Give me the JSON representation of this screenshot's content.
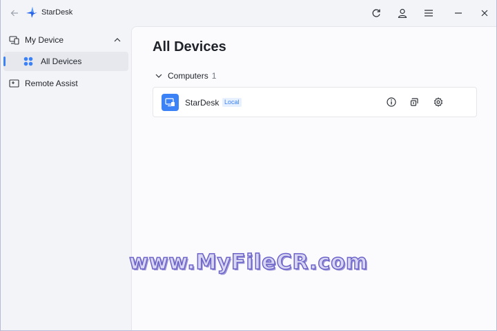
{
  "app": {
    "title": "StarDesk"
  },
  "sidebar": {
    "items": [
      {
        "label": "My Device",
        "icon": "devices-icon",
        "expanded": true
      },
      {
        "label": "All Devices",
        "icon": "grid-dots-icon",
        "selected": true
      },
      {
        "label": "Remote Assist",
        "icon": "remote-assist-icon"
      }
    ]
  },
  "main": {
    "title": "All Devices",
    "group": {
      "label": "Computers",
      "count": "1",
      "expanded": true
    },
    "devices": [
      {
        "name": "StarDesk",
        "badge": "Local",
        "icon": "computer-icon"
      }
    ]
  },
  "watermark": {
    "text": "www.MyFileCR.com"
  },
  "colors": {
    "accent": "#3b82f6",
    "badge_bg": "#e6f0fe",
    "sidebar_bg": "#f3f4f8"
  }
}
